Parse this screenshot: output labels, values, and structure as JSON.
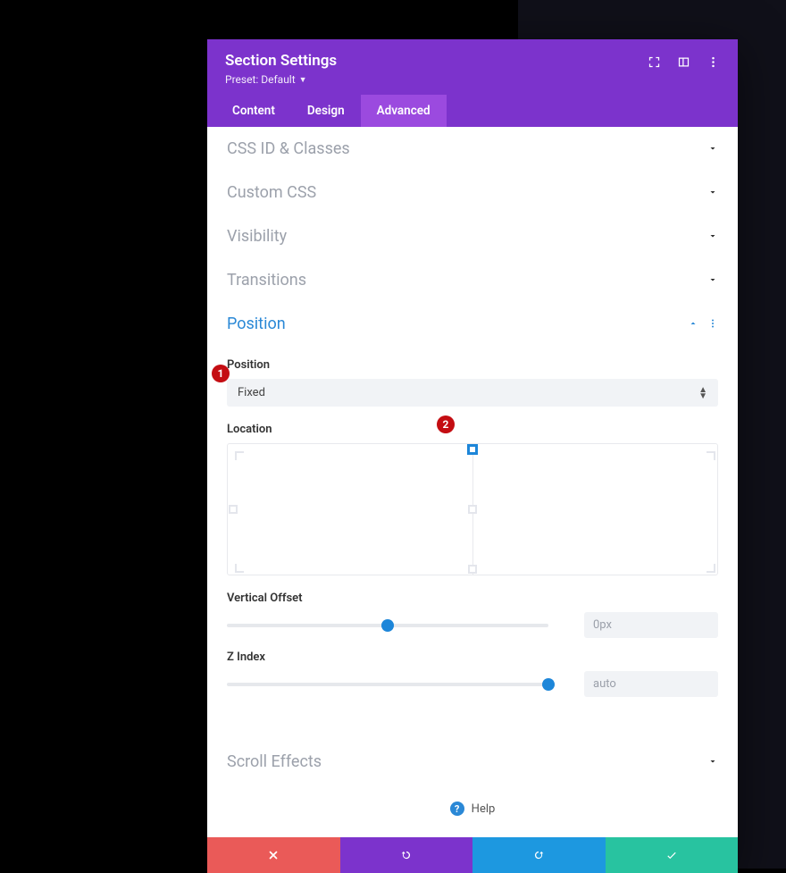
{
  "header": {
    "title": "Section Settings",
    "preset_label": "Preset: Default",
    "icons": {
      "expand": "expand-icon",
      "toggle": "sidebar-toggle-icon",
      "more": "kebab-icon"
    }
  },
  "tabs": {
    "content": "Content",
    "design": "Design",
    "advanced": "Advanced",
    "active": "advanced"
  },
  "accordions": {
    "css": {
      "title": "CSS ID & Classes",
      "open": false
    },
    "customcss": {
      "title": "Custom CSS",
      "open": false
    },
    "visibility": {
      "title": "Visibility",
      "open": false
    },
    "transitions": {
      "title": "Transitions",
      "open": false
    },
    "position": {
      "title": "Position",
      "open": true
    },
    "scroll": {
      "title": "Scroll Effects",
      "open": false
    }
  },
  "position": {
    "position_label": "Position",
    "position_value": "Fixed",
    "location_label": "Location",
    "location_selected": "top-center",
    "vertical_offset_label": "Vertical Offset",
    "vertical_offset_value": "0px",
    "vertical_offset_percent": 50,
    "z_index_label": "Z Index",
    "z_index_value": "auto",
    "z_index_percent": 100
  },
  "help": {
    "label": "Help"
  },
  "footer": {
    "cancel": "cancel",
    "undo": "undo",
    "redo": "redo",
    "save": "save"
  },
  "annotations": {
    "badge1": "1",
    "badge2": "2"
  }
}
